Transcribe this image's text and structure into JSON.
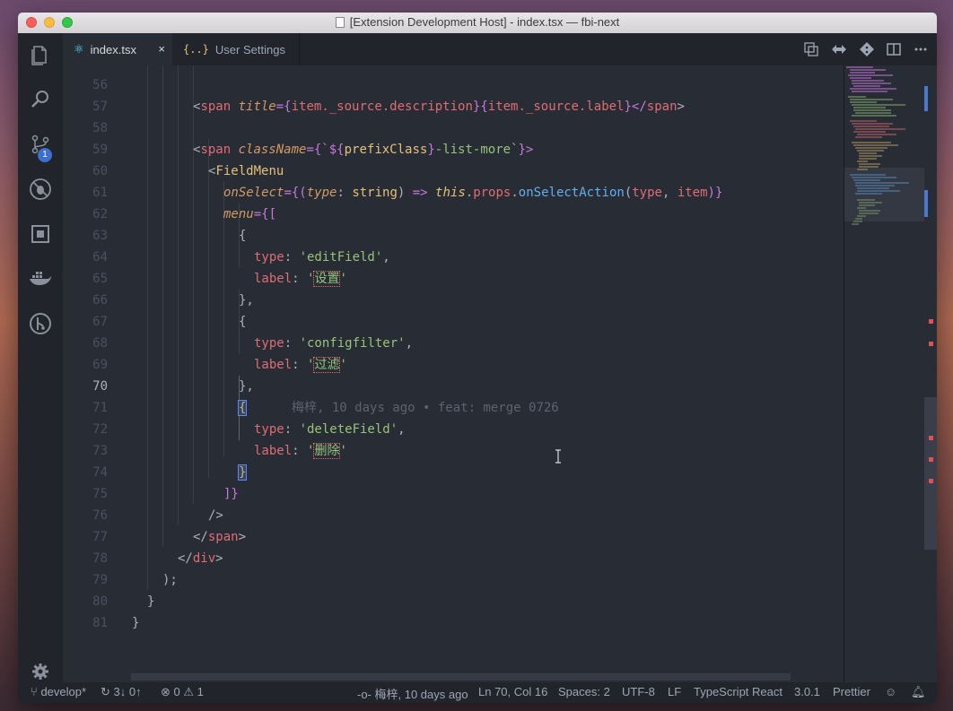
{
  "window": {
    "title": "[Extension Development Host] - index.tsx — fbi-next"
  },
  "activity_bar": {
    "items": [
      "explorer",
      "search",
      "source-control",
      "debug",
      "extensions",
      "docker",
      "gitlens"
    ],
    "source_control_badge": "1"
  },
  "tabs": [
    {
      "label": "index.tsx",
      "icon": "react-icon",
      "active": true,
      "close": "×"
    },
    {
      "label": "User Settings",
      "icon": "braces-icon",
      "active": false
    }
  ],
  "editor": {
    "active_line": "70",
    "lines": [
      {
        "n": "56"
      },
      {
        "n": "57"
      },
      {
        "n": "58"
      },
      {
        "n": "59"
      },
      {
        "n": "60"
      },
      {
        "n": "61"
      },
      {
        "n": "62"
      },
      {
        "n": "63"
      },
      {
        "n": "64"
      },
      {
        "n": "65"
      },
      {
        "n": "66"
      },
      {
        "n": "67"
      },
      {
        "n": "68"
      },
      {
        "n": "69"
      },
      {
        "n": "70"
      },
      {
        "n": "71"
      },
      {
        "n": "72"
      },
      {
        "n": "73"
      },
      {
        "n": "74"
      },
      {
        "n": "75"
      },
      {
        "n": "76"
      },
      {
        "n": "77"
      },
      {
        "n": "78"
      },
      {
        "n": "79"
      },
      {
        "n": "80"
      },
      {
        "n": "81"
      }
    ],
    "code": {
      "l56": {
        "open": "<",
        "tag": "span",
        "attr": "title",
        "eq": "={",
        "expr": "item._source.description",
        "close": "}{",
        "expr2": "item._source.label",
        "end": "}</",
        "tag2": "span",
        "gt": ">"
      },
      "l58": {
        "open": "<",
        "tag": "span",
        "attr": "className",
        "eq": "={`",
        "interp_open": "${",
        "ident": "prefixClass",
        "interp_close": "}",
        "rest": "-list-more`",
        "close": "}>"
      },
      "l59": {
        "open": "<",
        "comp": "FieldMenu"
      },
      "l60": {
        "attr": "onSelect",
        "eq": "={(",
        "param": "type",
        "colon": ": ",
        "type": "string",
        "paren": ") ",
        "arrow": "=>",
        "sp": " ",
        "this": "this",
        "dot1": ".",
        "props": "props",
        "dot2": ".",
        "fn": "onSelectAction",
        "args_open": "(",
        "a1": "type",
        "comma": ", ",
        "a2": "item",
        "args_close": ")}"
      },
      "l61": {
        "attr": "menu",
        "eq": "={["
      },
      "l62": {
        "brace": "{"
      },
      "l63": {
        "key": "type",
        "colon": ": ",
        "val": "'editField'",
        "comma": ","
      },
      "l64": {
        "key": "label",
        "colon": ": ",
        "q1": "'",
        "cjk": "设置",
        "q2": "'"
      },
      "l65": {
        "brace": "},"
      },
      "l66": {
        "brace": "{"
      },
      "l67": {
        "key": "type",
        "colon": ": ",
        "val": "'configfilter'",
        "comma": ","
      },
      "l68": {
        "key": "label",
        "colon": ": ",
        "q1": "'",
        "cjk": "过滤",
        "q2": "'"
      },
      "l69": {
        "brace": "},"
      },
      "l70": {
        "brace": "{",
        "blame": "梅梓, 10 days ago • feat: merge 0726"
      },
      "l71": {
        "key": "type",
        "colon": ": ",
        "val": "'deleteField'",
        "comma": ","
      },
      "l72": {
        "key": "label",
        "colon": ": ",
        "q1": "'",
        "cjk": "删除",
        "q2": "'"
      },
      "l73": {
        "brace": "}"
      },
      "l74": {
        "close": "]}"
      },
      "l75": {
        "close": "/>"
      },
      "l76": {
        "open": "</",
        "tag": "span",
        "gt": ">"
      },
      "l77": {
        "open": "</",
        "tag": "div",
        "gt": ">"
      },
      "l78": {
        "text": ");"
      },
      "l79": {
        "text": "}"
      },
      "l80": {
        "text": "}"
      }
    }
  },
  "status_bar": {
    "branch": "develop*",
    "sync": "3↓ 0↑",
    "errors": "0",
    "warnings": "1",
    "blame": "梅梓, 10 days ago",
    "position": "Ln 70, Col 16",
    "spaces": "Spaces: 2",
    "encoding": "UTF-8",
    "eol": "LF",
    "language": "TypeScript React",
    "ts_version": "3.0.1",
    "formatter": "Prettier"
  },
  "colors": {
    "editor_bg": "#282c34",
    "sidebar_bg": "#21252b",
    "accent": "#3d6fce"
  }
}
